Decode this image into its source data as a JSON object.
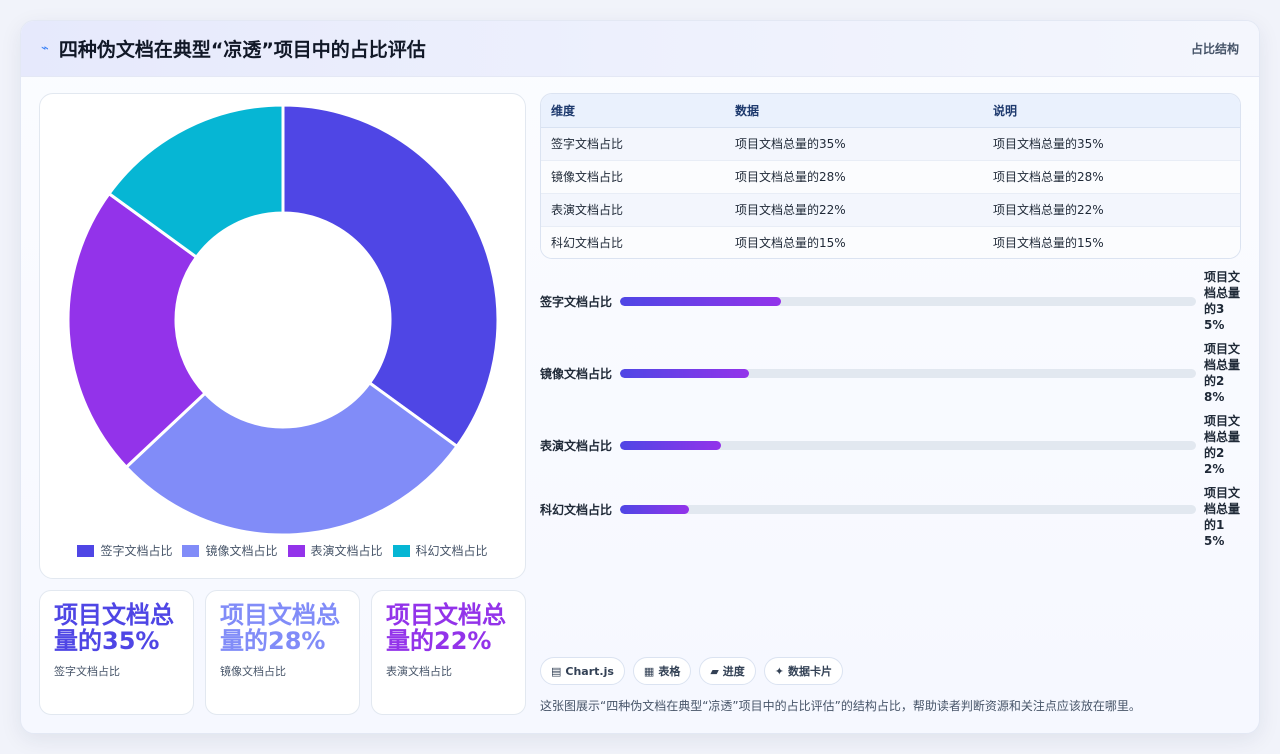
{
  "header": {
    "icon": "sparkline-icon",
    "title": "四种伪文档在典型“凉透”项目中的占比评估",
    "tag": "占比结构"
  },
  "chart_data": {
    "type": "pie",
    "categories": [
      "签字文档占比",
      "镜像文档占比",
      "表演文档占比",
      "科幻文档占比"
    ],
    "values": [
      35,
      28,
      22,
      15
    ],
    "colors": [
      "#4f46e5",
      "#818cf8",
      "#9333ea",
      "#06b6d4"
    ],
    "legend_position": "bottom"
  },
  "stat_cards": [
    {
      "value": "项目文档总量的35%",
      "label": "签字文档占比",
      "color": "#4f46e5"
    },
    {
      "value": "项目文档总量的28%",
      "label": "镜像文档占比",
      "color": "#818cf8"
    },
    {
      "value": "项目文档总量的22%",
      "label": "表演文档占比",
      "color": "#9333ea"
    }
  ],
  "table": {
    "headers": [
      "维度",
      "数据",
      "说明"
    ],
    "rows": [
      [
        "签字文档占比",
        "项目文档总量的35%",
        "项目文档总量的35%"
      ],
      [
        "镜像文档占比",
        "项目文档总量的28%",
        "项目文档总量的28%"
      ],
      [
        "表演文档占比",
        "项目文档总量的22%",
        "项目文档总量的22%"
      ],
      [
        "科幻文档占比",
        "项目文档总量的15%",
        "项目文档总量的15%"
      ]
    ]
  },
  "progress": [
    {
      "label": "签字文档占比",
      "value_text": "项目文档总量的35%",
      "fraction": 0.28
    },
    {
      "label": "镜像文档占比",
      "value_text": "项目文档总量的28%",
      "fraction": 0.224
    },
    {
      "label": "表演文档占比",
      "value_text": "项目文档总量的22%",
      "fraction": 0.176
    },
    {
      "label": "科幻文档占比",
      "value_text": "项目文档总量的15%",
      "fraction": 0.12
    }
  ],
  "chips": [
    {
      "icon": "chart-icon",
      "glyph": "▤",
      "label": "Chart.js"
    },
    {
      "icon": "table-icon",
      "glyph": "▦",
      "label": "表格"
    },
    {
      "icon": "progress-icon",
      "glyph": "▰",
      "label": "进度"
    },
    {
      "icon": "sparkle-icon",
      "glyph": "✦",
      "label": "数据卡片"
    }
  ],
  "caption": "这张图展示“四种伪文档在典型“凉透”项目中的占比评估”的结构占比，帮助读者判断资源和关注点应该放在哪里。"
}
